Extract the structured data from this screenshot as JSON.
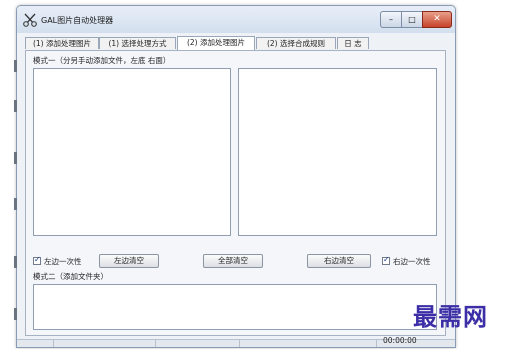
{
  "window": {
    "title": "GAL图片自动处理器",
    "controls": {
      "minimize": "–",
      "maximize": "□",
      "close": "✕"
    }
  },
  "tabs": [
    {
      "label": "(1) 添加处理图片",
      "active": false
    },
    {
      "label": "(1) 选择处理方式",
      "active": false
    },
    {
      "label": "(2) 添加处理图片",
      "active": true
    },
    {
      "label": "(2) 选择合成规则",
      "active": false
    },
    {
      "label": "日 志",
      "active": false
    }
  ],
  "panel": {
    "mode1_label": "模式一（分另手动添加文件，左底 右面）",
    "left_once_checkbox": {
      "label": "左边一次性",
      "checked": true
    },
    "clear_left_button": "左边清空",
    "clear_all_button": "全部清空",
    "clear_right_button": "右边清空",
    "right_once_checkbox": {
      "label": "右边一次性",
      "checked": true
    },
    "mode2_label": "模式二（添加文件夹）"
  },
  "statusbar": {
    "time": "00:00:00"
  },
  "watermark": "最需网",
  "colors": {
    "titlebar": "#dbe5f2",
    "close_button": "#c7432a",
    "watermark": "#3b2ea6"
  }
}
